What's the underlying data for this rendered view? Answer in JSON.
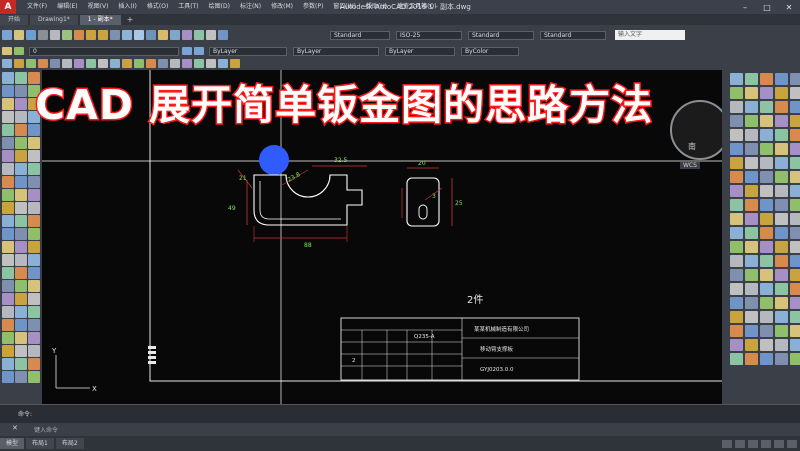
{
  "titlebar": {
    "title": "Autodesk AutoCAD 2016    1 - 副本.dwg",
    "menus": [
      "文件(F)",
      "编辑(E)",
      "视图(V)",
      "插入(I)",
      "格式(O)",
      "工具(T)",
      "绘图(D)",
      "标注(N)",
      "修改(M)",
      "参数(P)",
      "窗口(W)",
      "帮助(H)",
      "速查工具箱(Q)"
    ]
  },
  "tabs": [
    "开始",
    "Drawing1*",
    "1 - 副本*"
  ],
  "toolbar": {
    "text_style": "Standard",
    "dim_style": "ISO-25",
    "table_style": "Standard",
    "mleader_style": "Standard",
    "search_placeholder": "输入文字",
    "layer": "0",
    "color": "ByLayer",
    "linetype": "ByLayer",
    "lineweight": "ByLayer",
    "plotstyle": "ByColor"
  },
  "headline": "CAD 展开简单钣金图的思路方法",
  "compass": {
    "label": "南"
  },
  "wcs_badge": "WCS",
  "drawing": {
    "dims": [
      "32.5",
      "21",
      "49",
      "23.8",
      "88",
      "20",
      "25",
      "3"
    ],
    "sheet_label": "2件",
    "title_block": {
      "company": "某某机械制造有限公司",
      "part_name": "移动臂支撑板",
      "drawing_no": "GYJ0203.0.0",
      "material": "Q235-A",
      "qty": "2"
    }
  },
  "command": {
    "label": "命令:",
    "placeholder": "键入命令"
  },
  "layout_tabs": [
    "模型",
    "布局1",
    "布局2"
  ],
  "colors": {
    "crosshair": "#ffffff",
    "part_lines": "#ffffff",
    "dimension": "#d03434",
    "dim_text": "#7fe860",
    "border": "#e8e8e8",
    "highlight_blob": "#2f5bff",
    "headline_stroke": "#ff1a1a"
  }
}
